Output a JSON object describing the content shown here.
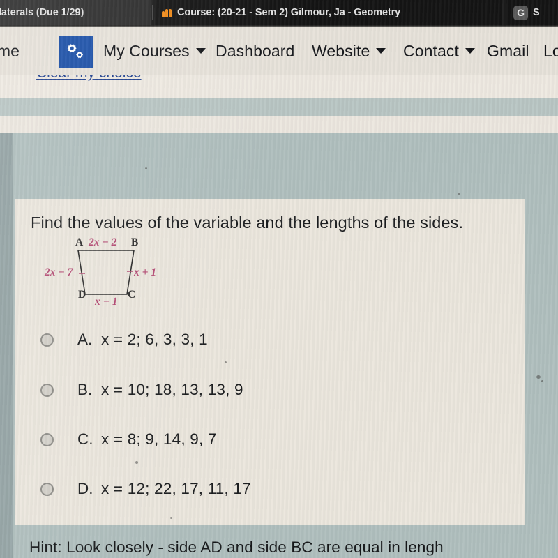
{
  "browser": {
    "tabs": [
      {
        "title": "laterals (Due 1/29)",
        "icon": "none",
        "active": true
      },
      {
        "title": "Course: (20-21 - Sem 2) Gilmour, Ja - Geometry",
        "icon": "moodle-icon",
        "active": false
      },
      {
        "title": "S",
        "icon": "google-icon",
        "active": false
      }
    ]
  },
  "navbar": {
    "home": "ome",
    "gear_icon": "gears-icon",
    "my_courses": "My Courses",
    "dashboard": "Dashboard",
    "website": "Website",
    "contact": "Contact",
    "gmail": "Gmail",
    "logout": "Lo"
  },
  "page": {
    "clear_choice": "Clear my choice"
  },
  "question": {
    "prompt": "Find the values of the variable and the lengths of the sides.",
    "figure": {
      "shape": "trapezoid",
      "vertices": [
        "A",
        "B",
        "C",
        "D"
      ],
      "side_top_AB": "2x − 2",
      "side_left_AD": "2x − 7",
      "side_right_BC": "x + 1",
      "side_bottom_DC": "x − 1"
    },
    "options": [
      {
        "letter": "A.",
        "text": "x = 2; 6, 3, 3, 1",
        "selected": false
      },
      {
        "letter": "B.",
        "text": "x = 10; 18, 13, 13, 9",
        "selected": false
      },
      {
        "letter": "C.",
        "text": "x = 8; 9, 14, 9, 7",
        "selected": false
      },
      {
        "letter": "D.",
        "text": "x = 12; 22, 17, 11, 17",
        "selected": false
      }
    ]
  },
  "hint": {
    "text": "Hint:  Look closely - side AD and side BC are equal in lengh"
  },
  "colors": {
    "tab_bar": "#1c1c1c",
    "nav_bar": "#e7e2da",
    "gear_tile": "#1a4fa8",
    "page_background": "#b0bfbe",
    "card_background": "#ebe6dd",
    "link_blue": "#1d3f8e",
    "figure_expression": "#b44a73",
    "moodle_orange": "#f28b18"
  }
}
